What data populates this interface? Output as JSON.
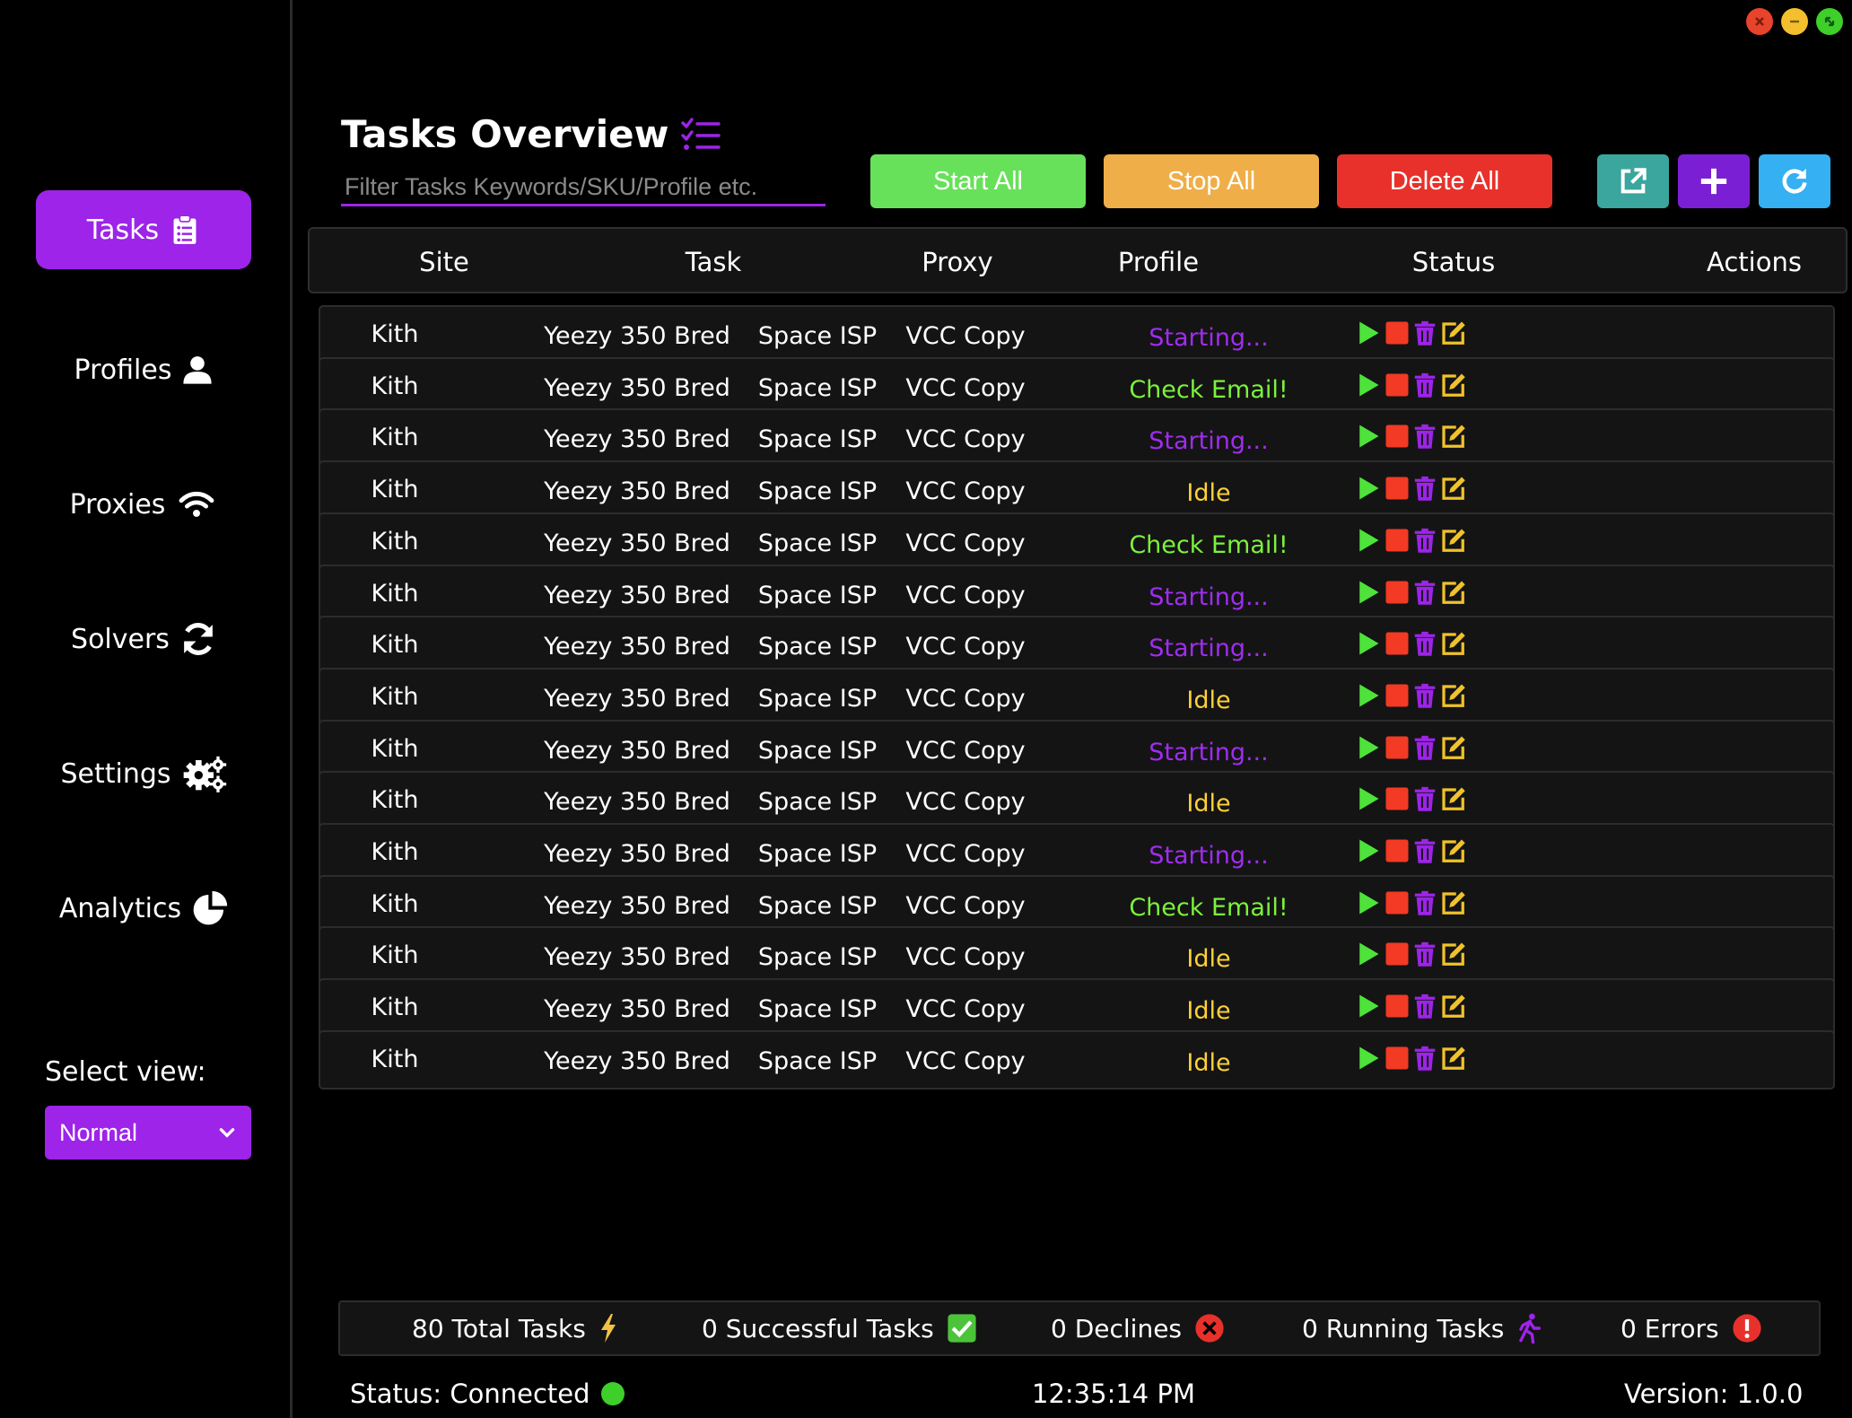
{
  "window_controls": [
    "close",
    "minimize",
    "expand"
  ],
  "sidebar": {
    "items": [
      {
        "label": "Tasks",
        "icon": "clipboard-list-icon",
        "active": true
      },
      {
        "label": "Profiles",
        "icon": "user-icon",
        "active": false
      },
      {
        "label": "Proxies",
        "icon": "wifi-icon",
        "active": false
      },
      {
        "label": "Solvers",
        "icon": "sync-icon",
        "active": false
      },
      {
        "label": "Settings",
        "icon": "gears-icon",
        "active": false
      },
      {
        "label": "Analytics",
        "icon": "pie-chart-icon",
        "active": false
      }
    ],
    "select_label": "Select view:",
    "select_value": "Normal"
  },
  "header": {
    "title": "Tasks Overview",
    "filter_placeholder": "Filter Tasks Keywords/SKU/Profile etc.",
    "buttons": {
      "start_all": "Start All",
      "stop_all": "Stop All",
      "delete_all": "Delete All"
    },
    "icon_buttons": [
      "external-link-icon",
      "plus-icon",
      "refresh-icon"
    ]
  },
  "table": {
    "columns": [
      "Site",
      "Task",
      "Proxy",
      "Profile",
      "Status",
      "Actions"
    ],
    "rows": [
      {
        "site": "Kith",
        "task": "Yeezy 350 Bred",
        "proxy": "Space ISP",
        "profile": "VCC Copy",
        "status": "Starting..."
      },
      {
        "site": "Kith",
        "task": "Yeezy 350 Bred",
        "proxy": "Space ISP",
        "profile": "VCC Copy",
        "status": "Check Email!"
      },
      {
        "site": "Kith",
        "task": "Yeezy 350 Bred",
        "proxy": "Space ISP",
        "profile": "VCC Copy",
        "status": "Starting..."
      },
      {
        "site": "Kith",
        "task": "Yeezy 350 Bred",
        "proxy": "Space ISP",
        "profile": "VCC Copy",
        "status": "Idle"
      },
      {
        "site": "Kith",
        "task": "Yeezy 350 Bred",
        "proxy": "Space ISP",
        "profile": "VCC Copy",
        "status": "Check Email!"
      },
      {
        "site": "Kith",
        "task": "Yeezy 350 Bred",
        "proxy": "Space ISP",
        "profile": "VCC Copy",
        "status": "Starting..."
      },
      {
        "site": "Kith",
        "task": "Yeezy 350 Bred",
        "proxy": "Space ISP",
        "profile": "VCC Copy",
        "status": "Starting..."
      },
      {
        "site": "Kith",
        "task": "Yeezy 350 Bred",
        "proxy": "Space ISP",
        "profile": "VCC Copy",
        "status": "Idle"
      },
      {
        "site": "Kith",
        "task": "Yeezy 350 Bred",
        "proxy": "Space ISP",
        "profile": "VCC Copy",
        "status": "Starting..."
      },
      {
        "site": "Kith",
        "task": "Yeezy 350 Bred",
        "proxy": "Space ISP",
        "profile": "VCC Copy",
        "status": "Idle"
      },
      {
        "site": "Kith",
        "task": "Yeezy 350 Bred",
        "proxy": "Space ISP",
        "profile": "VCC Copy",
        "status": "Starting..."
      },
      {
        "site": "Kith",
        "task": "Yeezy 350 Bred",
        "proxy": "Space ISP",
        "profile": "VCC Copy",
        "status": "Check Email!"
      },
      {
        "site": "Kith",
        "task": "Yeezy 350 Bred",
        "proxy": "Space ISP",
        "profile": "VCC Copy",
        "status": "Idle"
      },
      {
        "site": "Kith",
        "task": "Yeezy 350 Bred",
        "proxy": "Space ISP",
        "profile": "VCC Copy",
        "status": "Idle"
      },
      {
        "site": "Kith",
        "task": "Yeezy 350 Bred",
        "proxy": "Space ISP",
        "profile": "VCC Copy",
        "status": "Idle"
      }
    ],
    "row_actions": [
      "play-icon",
      "stop-icon",
      "trash-icon",
      "edit-icon"
    ]
  },
  "stats": [
    {
      "label": "80 Total Tasks",
      "icon": "bolt-icon"
    },
    {
      "label": "0 Successful Tasks",
      "icon": "check-square-icon"
    },
    {
      "label": "0 Declines",
      "icon": "x-circle-icon"
    },
    {
      "label": "0 Running Tasks",
      "icon": "running-icon"
    },
    {
      "label": "0 Errors",
      "icon": "exclamation-circle-icon"
    }
  ],
  "statusbar": {
    "status": "Status: Connected",
    "time": "12:35:14 PM",
    "version": "Version: 1.0.0"
  },
  "colors": {
    "accent": "#9d24e8",
    "start": "#68e15a",
    "stop": "#efae48",
    "delete": "#e8312b",
    "status_starting": "#a02cf0",
    "status_check_email": "#7cf23d",
    "status_idle": "#ffd03a"
  }
}
